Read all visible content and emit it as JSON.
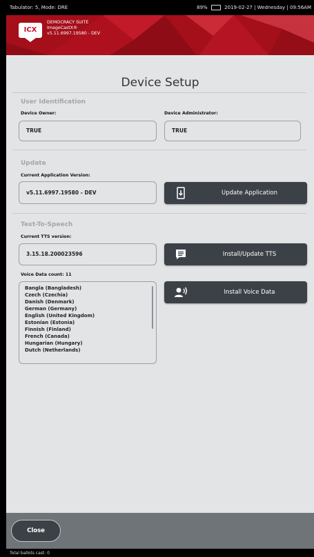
{
  "statusbar": {
    "left_text": "Tabulator: 5, Mode: DRE",
    "battery": "89%",
    "datetime": "2019-02-27 | Wednesday | 09:56AM"
  },
  "header": {
    "logo_text": "ICX",
    "line1": "DEMOCRACY SUITE",
    "line2": "ImageCastX®",
    "line3": "v5.11.6997.19580 - DEV"
  },
  "page": {
    "title": "Device Setup"
  },
  "user_identification": {
    "section_title": "User Identification",
    "owner_label": "Device Owner:",
    "owner_value": "TRUE",
    "admin_label": "Device Administrator:",
    "admin_value": "TRUE"
  },
  "update": {
    "section_title": "Update",
    "version_label": "Current Application Version:",
    "version_value": "v5.11.6997.19580 - DEV",
    "button_label": "Update Application"
  },
  "tts": {
    "section_title": "Text-To-Speech",
    "version_label": "Current TTS version:",
    "version_value": "3.15.18.200023596",
    "install_button_label": "Install/Update TTS",
    "voice_count_label": "Voice Data count: 11",
    "voice_button_label": "Install Voice Data",
    "voices": [
      "Bangla (Bangladesh)",
      "Czech (Czechia)",
      "Danish (Denmark)",
      "German (Germany)",
      "English (United Kingdom)",
      "Estonian (Estonia)",
      "Finnish (Finland)",
      "French (Canada)",
      "Hungarian (Hungary)",
      "Dutch (Netherlands)"
    ]
  },
  "footer": {
    "close_label": "Close",
    "ballots_text": "Total ballots cast: 0"
  },
  "colors": {
    "banner_red": "#a8101b",
    "button_dark": "#3c4148",
    "screen_bg": "#e2e4e6",
    "footer_bg": "#6f7478"
  }
}
